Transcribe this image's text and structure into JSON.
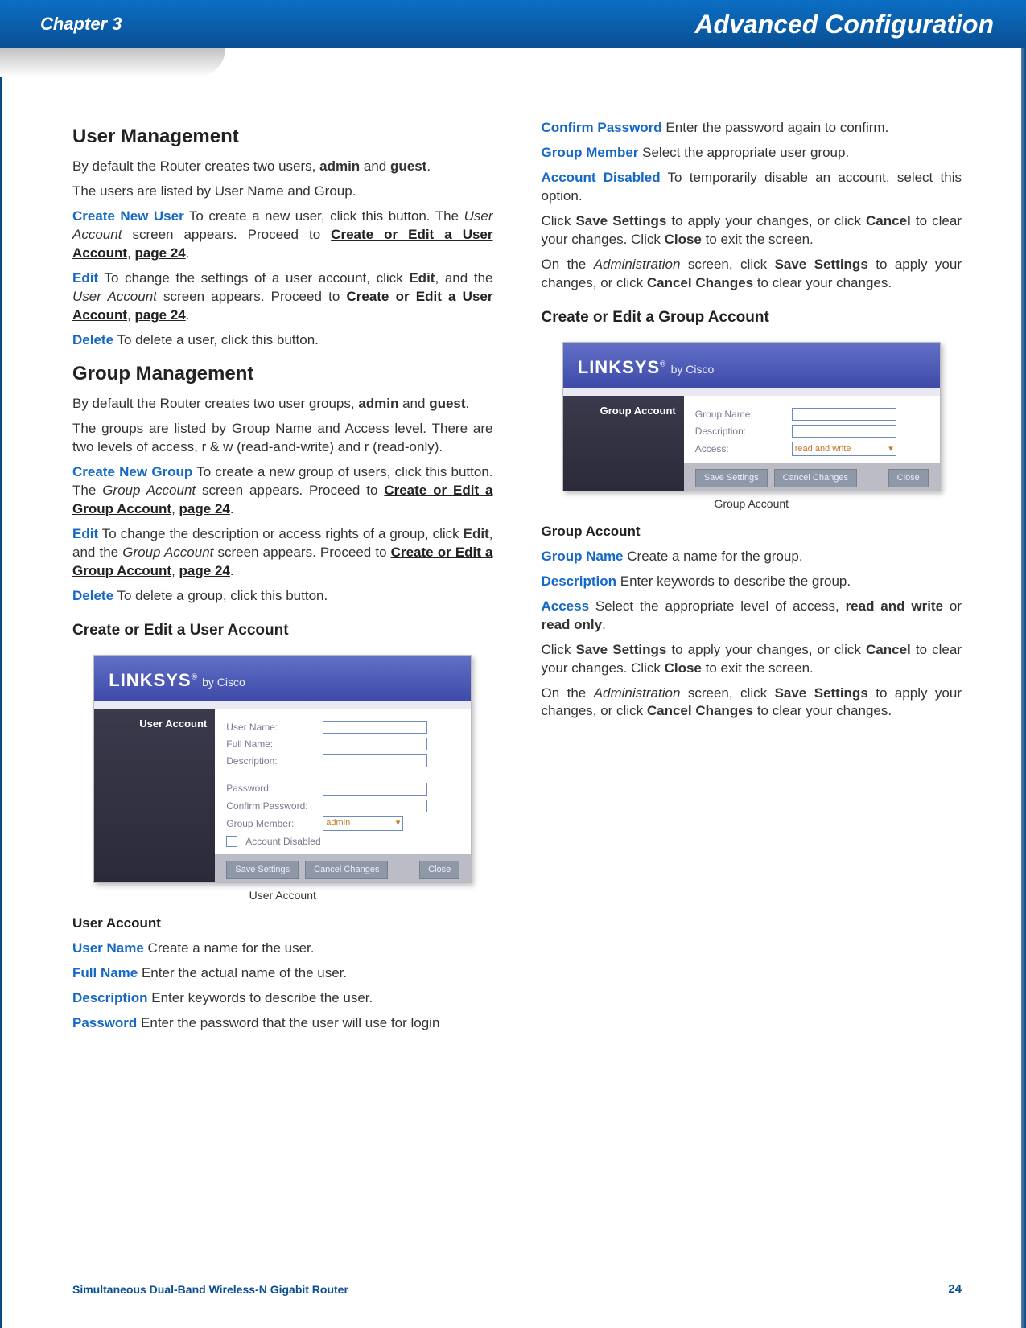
{
  "header": {
    "chapter": "Chapter 3",
    "title": "Advanced Configuration"
  },
  "footer": {
    "product": "Simultaneous Dual-Band Wireless-N Gigabit Router",
    "page": "24"
  },
  "left": {
    "h_user_mgmt": "User Management",
    "um_p1_a": "By default the Router creates two users, ",
    "um_p1_b": "admin",
    "um_p1_c": " and ",
    "um_p1_d": "guest",
    "um_p1_e": ".",
    "um_p2": "The users are listed by User Name and Group.",
    "um_cnu_label": "Create New User",
    "um_cnu_text_a": " To create a new user, click this button. The ",
    "um_cnu_text_b": "User Account",
    "um_cnu_text_c": " screen appears. Proceed to ",
    "um_cnu_link": "Create or Edit a User Account",
    "um_cnu_text_d": ", ",
    "um_cnu_page": "page 24",
    "um_cnu_text_e": ".",
    "um_edit_label": "Edit",
    "um_edit_text_a": " To change the settings of a user account, click ",
    "um_edit_text_b": "Edit",
    "um_edit_text_c": ", and the ",
    "um_edit_text_d": "User Account",
    "um_edit_text_e": " screen appears. Proceed to ",
    "um_edit_link": "Create or Edit a User Account",
    "um_edit_text_f": ", ",
    "um_edit_page": "page 24",
    "um_edit_text_g": ".",
    "um_del_label": "Delete",
    "um_del_text": "  To delete a user, click this button.",
    "h_group_mgmt": "Group Management",
    "gm_p1_a": "By default the Router creates two user groups, ",
    "gm_p1_b": "admin",
    "gm_p1_c": " and ",
    "gm_p1_d": "guest",
    "gm_p1_e": ".",
    "gm_p2": "The groups are listed by Group Name and Access level. There are two levels of access, r & w (read-and-write) and r (read-only).",
    "gm_cng_label": "Create New Group",
    "gm_cng_text_a": "  To create a new group of users, click this button. The ",
    "gm_cng_text_b": "Group Account",
    "gm_cng_text_c": " screen appears. Proceed to ",
    "gm_cng_link": "Create or Edit a Group Account",
    "gm_cng_text_d": ", ",
    "gm_cng_page": "page 24",
    "gm_cng_text_e": ".",
    "gm_edit_label": "Edit",
    "gm_edit_text_a": "  To change the description or access rights of a group, click ",
    "gm_edit_text_b": "Edit",
    "gm_edit_text_c": ", and the ",
    "gm_edit_text_d": "Group Account",
    "gm_edit_text_e": " screen appears. Proceed to ",
    "gm_edit_link": "Create or Edit a Group Account",
    "gm_edit_text_f": ", ",
    "gm_edit_page": "page 24",
    "gm_edit_text_g": ".",
    "gm_del_label": "Delete",
    "gm_del_text": "  To delete a group, click this button.",
    "h_create_user": "Create or Edit a User Account",
    "ua_caption": "User Account",
    "h_ua_sub": "User Account",
    "ua_un_label": "User Name",
    "ua_un_text": "  Create a name for the user.",
    "ua_fn_label": "Full Name",
    "ua_fn_text": "  Enter the actual name of the user.",
    "ua_desc_label": "Description",
    "ua_desc_text": "  Enter keywords to describe the user.",
    "ua_pw_label": "Password",
    "ua_pw_text": "  Enter the password that the user will use for login"
  },
  "right": {
    "cp_label": "Confirm Password",
    "cp_text": "  Enter the password again to confirm.",
    "gm_label": "Group Member",
    "gm_text": "  Select the appropriate user group.",
    "ad_label": "Account Disabled",
    "ad_text": " To temporarily disable an account, select this option.",
    "save1_a": "Click ",
    "save1_b": "Save Settings",
    "save1_c": " to apply your changes, or click ",
    "save1_d": "Cancel",
    "save1_e": " to clear your changes. Click ",
    "save1_f": "Close",
    "save1_g": " to exit the screen.",
    "admin1_a": "On the ",
    "admin1_b": "Administration",
    "admin1_c": " screen, click ",
    "admin1_d": "Save Settings",
    "admin1_e": " to apply your changes, or click ",
    "admin1_f": "Cancel Changes",
    "admin1_g": " to clear your changes.",
    "h_create_group": "Create or Edit a Group Account",
    "ga_caption": "Group Account",
    "h_ga_sub": "Group Account",
    "ga_gn_label": "Group Name",
    "ga_gn_text": "  Create a name for the group.",
    "ga_desc_label": "Description",
    "ga_desc_text": "  Enter keywords to describe the group.",
    "ga_acc_label": "Access",
    "ga_acc_text_a": "  Select the appropriate level of access, ",
    "ga_acc_text_b": "read and write",
    "ga_acc_text_c": " or ",
    "ga_acc_text_d": "read only",
    "ga_acc_text_e": ".",
    "save2_a": "Click ",
    "save2_b": "Save Settings",
    "save2_c": " to apply your changes, or click ",
    "save2_d": "Cancel",
    "save2_e": " to clear your changes. Click ",
    "save2_f": "Close",
    "save2_g": " to exit the screen.",
    "admin2_a": "On the ",
    "admin2_b": "Administration",
    "admin2_c": " screen, click ",
    "admin2_d": "Save Settings",
    "admin2_e": " to apply your changes, or click ",
    "admin2_f": "Cancel Changes",
    "admin2_g": " to clear your changes."
  },
  "shot_user": {
    "brand": "LINKSYS",
    "by": "by Cisco",
    "side": "User Account",
    "rows": {
      "user_name": "User Name:",
      "full_name": "Full Name:",
      "description": "Description:",
      "password": "Password:",
      "confirm": "Confirm Password:",
      "group": "Group Member:",
      "group_val": "admin",
      "disabled": "Account Disabled"
    },
    "btns": {
      "save": "Save Settings",
      "cancel": "Cancel Changes",
      "close": "Close"
    }
  },
  "shot_group": {
    "brand": "LINKSYS",
    "by": "by Cisco",
    "side": "Group Account",
    "rows": {
      "group_name": "Group Name:",
      "description": "Description:",
      "access": "Access:",
      "access_val": "read and write"
    },
    "btns": {
      "save": "Save Settings",
      "cancel": "Cancel Changes",
      "close": "Close"
    }
  }
}
